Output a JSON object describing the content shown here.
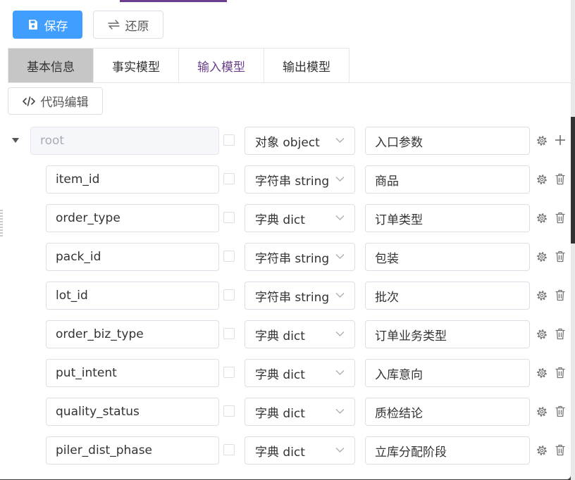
{
  "toolbar": {
    "save_label": "保存",
    "restore_label": "还原"
  },
  "tabs": [
    {
      "label": "基本信息"
    },
    {
      "label": "事实模型"
    },
    {
      "label": "输入模型"
    },
    {
      "label": "输出模型"
    }
  ],
  "code_edit_label": "代码编辑",
  "icons": {
    "save": "save-icon",
    "restore": "swap-icon",
    "code": "code-icon",
    "expand": "caret-down-icon",
    "settings": "gear-icon",
    "add": "plus-icon",
    "delete": "trash-icon"
  },
  "colors": {
    "primary": "#409eff",
    "active_tab_bg": "#c6c6c6",
    "accent_tab_text": "#6b3f8e"
  },
  "root": {
    "name": "root",
    "type": "对象 object",
    "description": "入口参数"
  },
  "fields": [
    {
      "name": "item_id",
      "type": "字符串 string",
      "description": "商品"
    },
    {
      "name": "order_type",
      "type": "字典 dict",
      "description": "订单类型"
    },
    {
      "name": "pack_id",
      "type": "字符串 string",
      "description": "包装"
    },
    {
      "name": "lot_id",
      "type": "字符串 string",
      "description": "批次"
    },
    {
      "name": "order_biz_type",
      "type": "字典 dict",
      "description": "订单业务类型"
    },
    {
      "name": "put_intent",
      "type": "字典 dict",
      "description": "入库意向"
    },
    {
      "name": "quality_status",
      "type": "字典 dict",
      "description": "质检结论"
    },
    {
      "name": "piler_dist_phase",
      "type": "字典 dict",
      "description": "立库分配阶段"
    }
  ]
}
